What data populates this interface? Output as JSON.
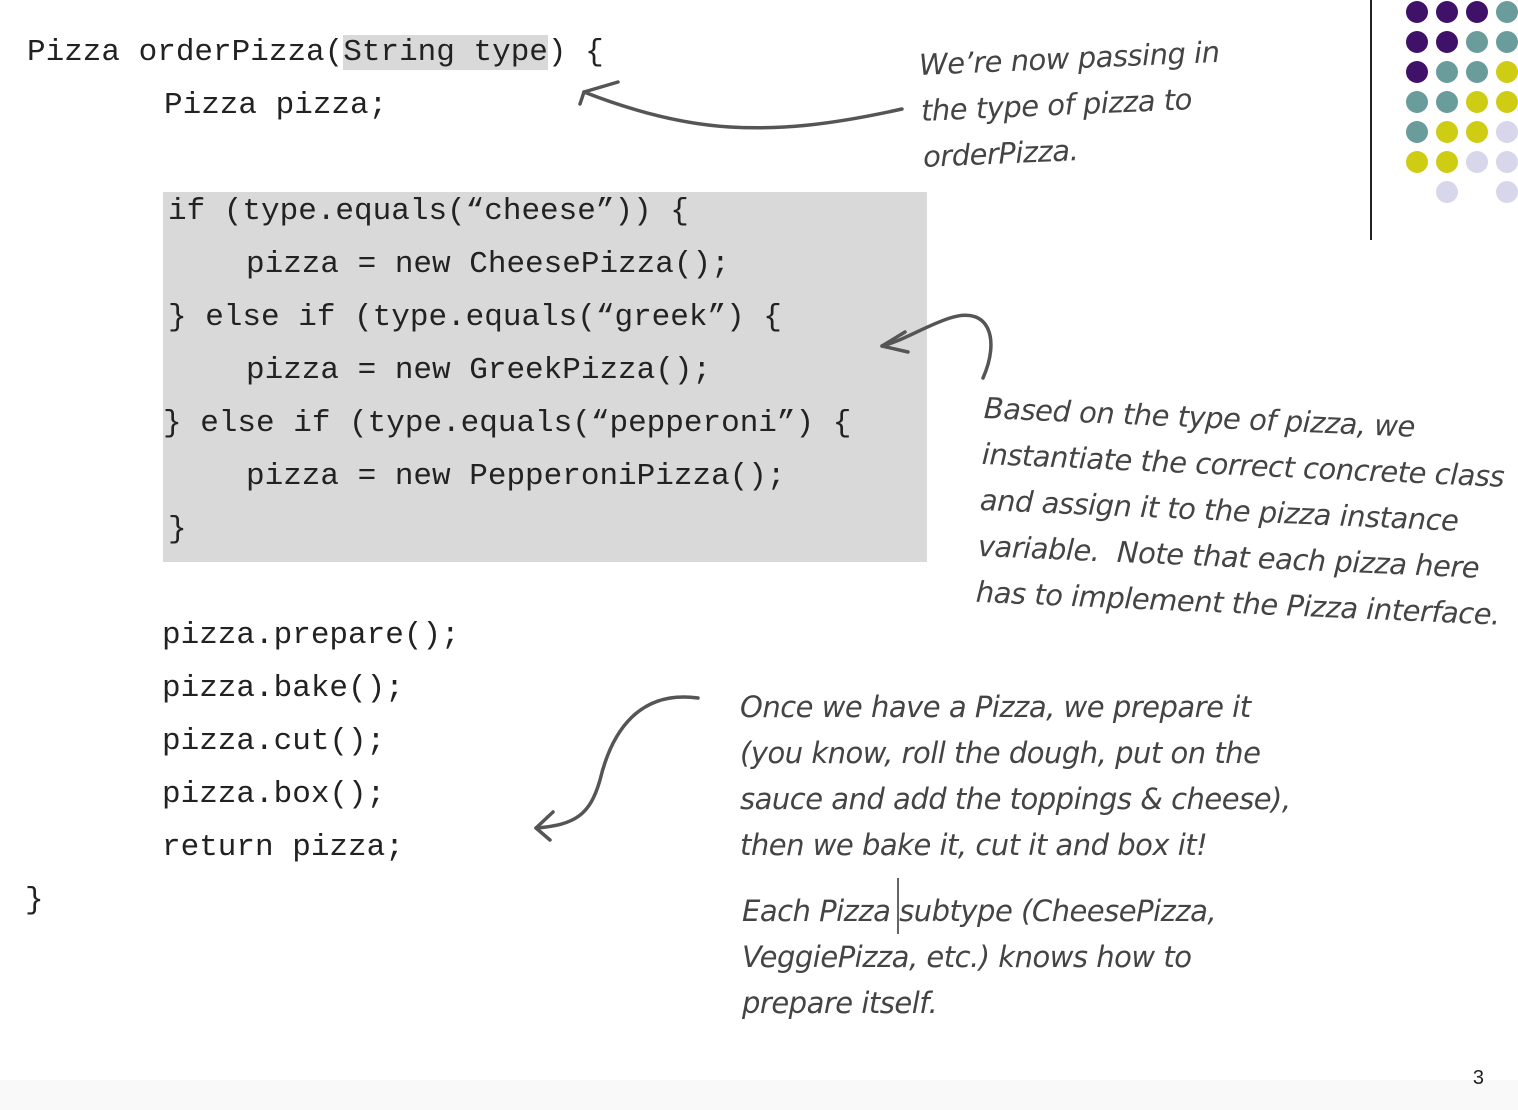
{
  "code": {
    "l1_pre": "Pizza orderPizza(",
    "l1_hl": "String type",
    "l1_post": ") {",
    "l2": "Pizza pizza;",
    "l3": "if (type.equals(“cheese”)) {",
    "l4": "pizza = new CheesePizza();",
    "l5": "} else if (type.equals(“greek”) {",
    "l6": "pizza = new GreekPizza();",
    "l7": "} else if (type.equals(“pepperoni”) {",
    "l8": "pizza = new PepperoniPizza();",
    "l9": "}",
    "l10": "pizza.prepare();",
    "l11": "pizza.bake();",
    "l12": "pizza.cut();",
    "l13": "pizza.box();",
    "l14": "return pizza;",
    "l15": "}"
  },
  "notes": {
    "n1": "We’re now passing in\nthe type of pizza to\norderPizza.",
    "n2": "Based on the type of pizza, we\ninstantiate the correct concrete class\nand assign it to the pizza instance\nvariable.  Note that each pizza here\nhas to implement the Pizza interface.",
    "n3": "Once we have a Pizza, we prepare it\n(you know, roll the dough, put on the\nsauce and add the toppings & cheese),\nthen we bake it, cut it and box it!",
    "n4": "Each Pizza subtype (CheesePizza,\nVeggiePizza, etc.) knows how to\nprepare itself."
  },
  "page_number": "3",
  "colors": {
    "purple": "#3f1168",
    "teal": "#6b9c9c",
    "yellow": "#cfcc14",
    "lavender": "#d7d6ea"
  }
}
